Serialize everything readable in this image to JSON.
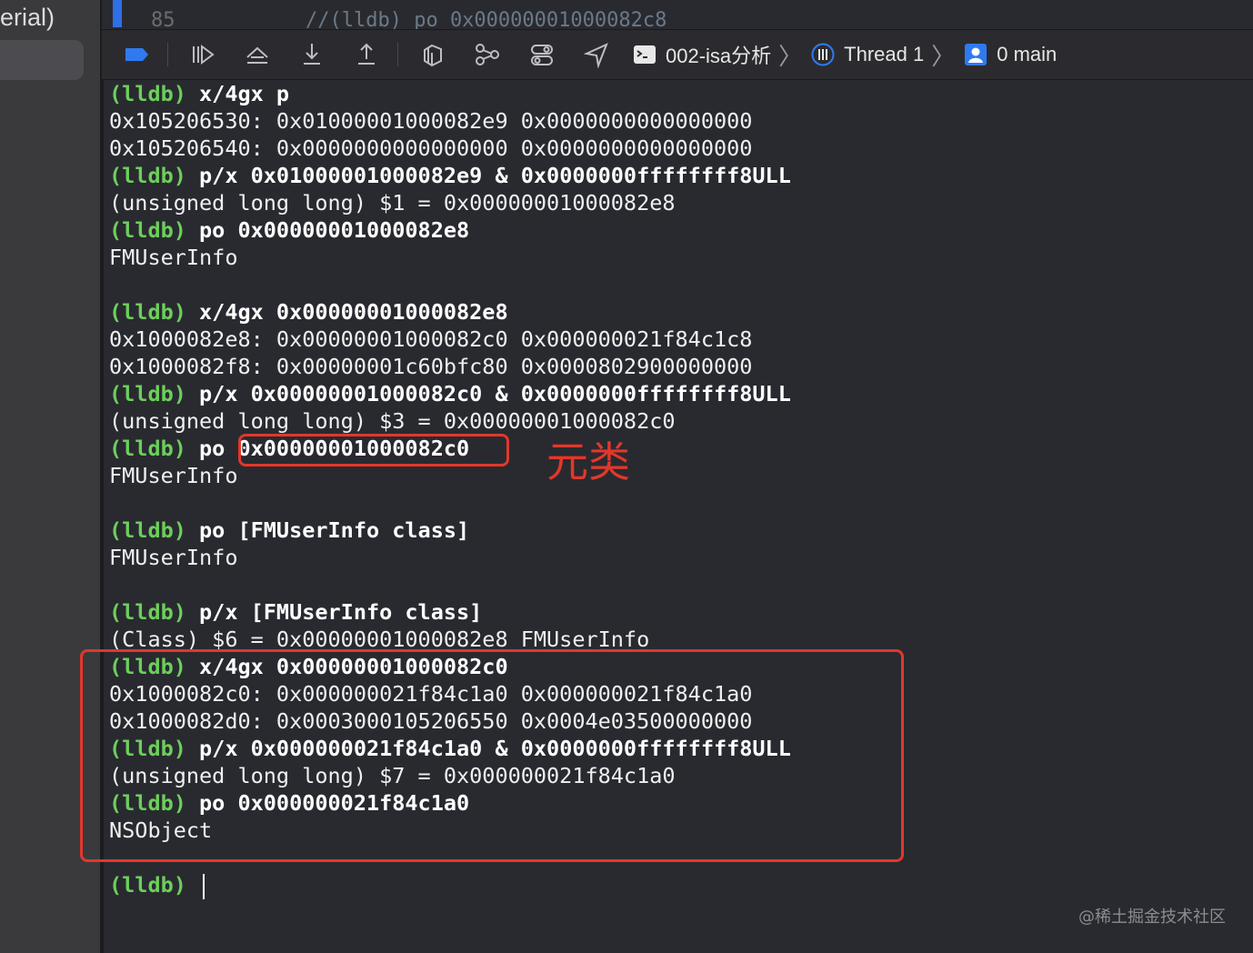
{
  "sidebar": {
    "partial_text": "erial)"
  },
  "code_top": {
    "line_number": "85",
    "comment": "//(lldb) po 0x00000001000082c8"
  },
  "toolbar": {
    "icons": [
      "breakpoints-toggle-icon",
      "continue-icon",
      "step-over-icon",
      "step-into-icon",
      "step-out-icon",
      "view-hierarchy-icon",
      "memory-graph-icon",
      "environment-overrides-icon",
      "simulate-location-icon"
    ],
    "scheme": "002-isa分析",
    "thread": "Thread 1",
    "frame": "0 main"
  },
  "console": {
    "prompt": "(lldb)",
    "lines": [
      {
        "type": "cmd",
        "text": " x/4gx p"
      },
      {
        "type": "out",
        "text": "0x105206530: 0x01000001000082e9 0x0000000000000000"
      },
      {
        "type": "out",
        "text": "0x105206540: 0x0000000000000000 0x0000000000000000"
      },
      {
        "type": "cmd",
        "text": " p/x 0x01000001000082e9 & 0x0000000ffffffff8ULL"
      },
      {
        "type": "out",
        "text": "(unsigned long long) $1 = 0x00000001000082e8"
      },
      {
        "type": "cmd",
        "text": " po 0x00000001000082e8"
      },
      {
        "type": "out",
        "text": "FMUserInfo"
      },
      {
        "type": "blank",
        "text": ""
      },
      {
        "type": "cmd",
        "text": " x/4gx 0x00000001000082e8"
      },
      {
        "type": "out",
        "text": "0x1000082e8: 0x00000001000082c0 0x000000021f84c1c8"
      },
      {
        "type": "out",
        "text": "0x1000082f8: 0x00000001c60bfc80 0x0000802900000000"
      },
      {
        "type": "cmd",
        "text": " p/x 0x00000001000082c0 & 0x0000000ffffffff8ULL"
      },
      {
        "type": "out",
        "text": "(unsigned long long) $3 = 0x00000001000082c0"
      },
      {
        "type": "cmd",
        "text": " po 0x00000001000082c0"
      },
      {
        "type": "out",
        "text": "FMUserInfo"
      },
      {
        "type": "blank",
        "text": ""
      },
      {
        "type": "cmd",
        "text": " po [FMUserInfo class]"
      },
      {
        "type": "out",
        "text": "FMUserInfo"
      },
      {
        "type": "blank",
        "text": ""
      },
      {
        "type": "cmd",
        "text": " p/x [FMUserInfo class]"
      },
      {
        "type": "out",
        "text": "(Class) $6 = 0x00000001000082e8 FMUserInfo"
      },
      {
        "type": "cmd",
        "text": " x/4gx 0x00000001000082c0"
      },
      {
        "type": "out",
        "text": "0x1000082c0: 0x000000021f84c1a0 0x000000021f84c1a0"
      },
      {
        "type": "out",
        "text": "0x1000082d0: 0x0003000105206550 0x0004e03500000000"
      },
      {
        "type": "cmd",
        "text": " p/x 0x000000021f84c1a0 & 0x0000000ffffffff8ULL"
      },
      {
        "type": "out",
        "text": "(unsigned long long) $7 = 0x000000021f84c1a0"
      },
      {
        "type": "cmd",
        "text": " po 0x000000021f84c1a0"
      },
      {
        "type": "out",
        "text": "NSObject"
      },
      {
        "type": "blank",
        "text": ""
      },
      {
        "type": "cmd",
        "text": " "
      }
    ]
  },
  "annotation": {
    "label": "元类",
    "color": "#e2372b"
  },
  "watermark": "@稀土掘金技术社区",
  "colors": {
    "background": "#292a30",
    "prompt": "#6ccf5a",
    "accent": "#2f6fe8"
  }
}
